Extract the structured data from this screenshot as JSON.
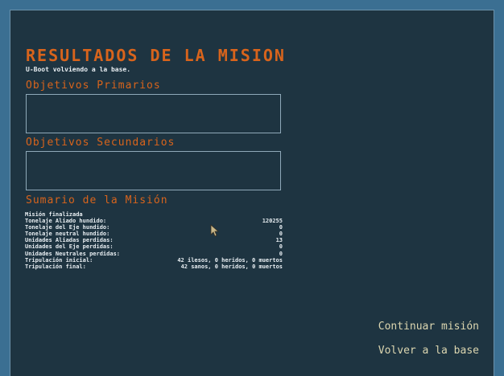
{
  "header": {
    "title": "RESULTADOS DE LA MISION",
    "status": "U-Boot volviendo a la base."
  },
  "sections": {
    "primary": "Objetivos Primarios",
    "secondary": "Objetivos Secundarios",
    "summary": "Sumario de la Misión"
  },
  "summary": {
    "mission_status": "Misión finalizada",
    "rows": [
      {
        "label": "Tonelaje Aliado hundido:",
        "value": "120255"
      },
      {
        "label": "Tonelaje del Eje hundido:",
        "value": "0"
      },
      {
        "label": "Tonelaje neutral hundido:",
        "value": "0"
      },
      {
        "label": "Unidades Aliadas perdidas:",
        "value": "13"
      },
      {
        "label": "Unidades del Eje perdidas:",
        "value": "0"
      },
      {
        "label": "Unidades Neutrales perdidas:",
        "value": "0"
      },
      {
        "label": "Tripulación inicial:",
        "value": "42 ilesos,  0 heridos,  0 muertos"
      },
      {
        "label": "Tripulación final:",
        "value": "42 sanos,  0 heridos,  0 muertos"
      }
    ]
  },
  "menu": {
    "continue": "Continuar misión",
    "return": "Volver a la base"
  },
  "colors": {
    "background": "#1e3441",
    "border": "#3b6f92",
    "heading": "#d8641c",
    "text": "#e8eef2",
    "menu": "#dcd6b0"
  }
}
